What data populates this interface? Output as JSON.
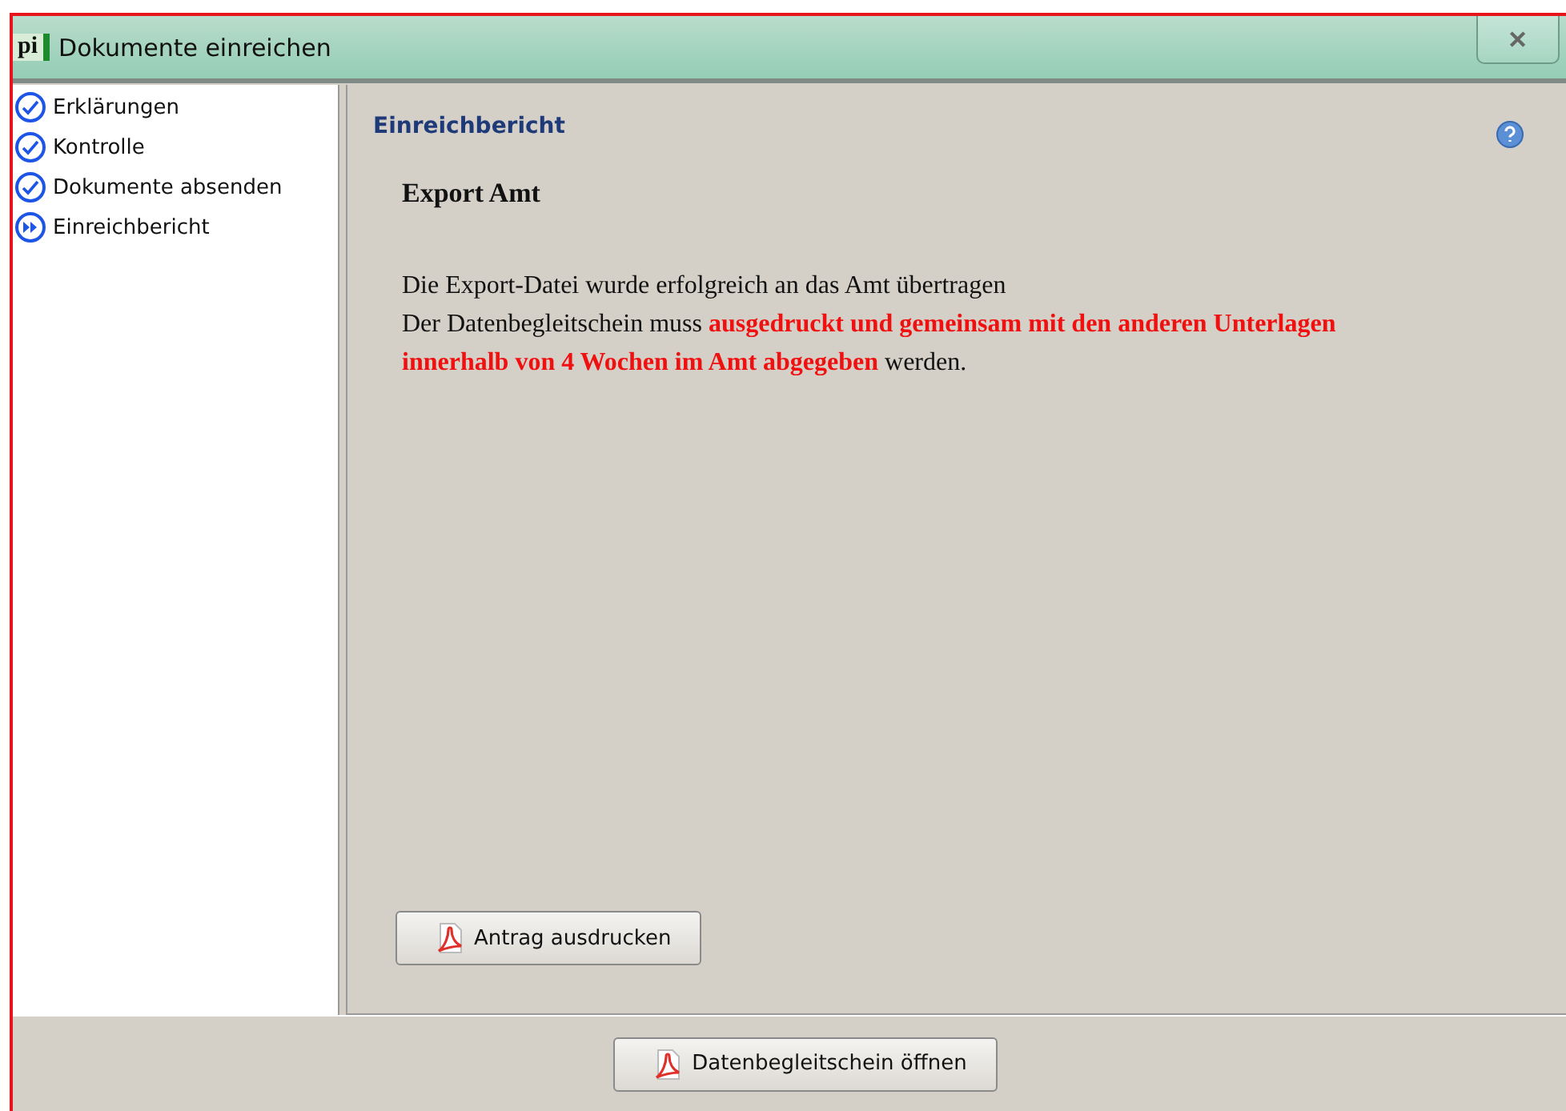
{
  "window": {
    "logo": "pi",
    "title": "Dokumente einreichen",
    "close": "✕"
  },
  "steps": [
    {
      "label": "Erklärungen",
      "kind": "done"
    },
    {
      "label": "Kontrolle",
      "kind": "done"
    },
    {
      "label": "Dokumente absenden",
      "kind": "done"
    },
    {
      "label": "Einreichbericht",
      "kind": "current"
    }
  ],
  "panel": {
    "title": "Einreichbericht",
    "heading": "Export Amt",
    "lines": [
      "Die Export-Datei wurde erfolgreich an das Amt übertragen",
      "Der Datenbegleitschein muss **ausgedruckt und gemeinsam mit den anderen Unterlagen innerhalb von 4 Wochen im Amt abgegeben** werden."
    ],
    "button": "Antrag ausdrucken"
  },
  "footer": {
    "button": "Datenbegleitschein öffnen"
  }
}
